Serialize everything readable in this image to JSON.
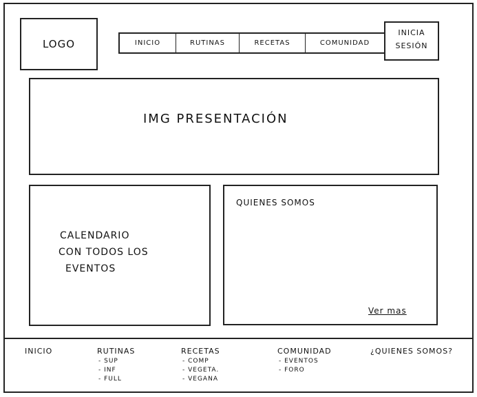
{
  "header": {
    "logo": "LOGO",
    "nav": [
      "INICIO",
      "RUTINAS",
      "RECETAS",
      "COMUNIDAD"
    ],
    "login_line1": "INICIA",
    "login_line2": "SESIÓN"
  },
  "hero": {
    "label": "IMG PRESENTACIÓN"
  },
  "calendar": {
    "lines": [
      "CALENDARIO",
      "CON TODOS LOS",
      "EVENTOS"
    ]
  },
  "about": {
    "title": "QUIENES SOMOS",
    "link": "Ver mas"
  },
  "footer": {
    "inicio": "INICIO",
    "rutinas": {
      "title": "RUTINAS",
      "items": [
        "- SUP",
        "- INF",
        "- FULL"
      ]
    },
    "recetas": {
      "title": "RECETAS",
      "items": [
        "- COMP",
        "- VEGETA.",
        "- VEGANA"
      ]
    },
    "comunidad": {
      "title": "COMUNIDAD",
      "items": [
        "- EVENTOS",
        "- FORO"
      ]
    },
    "quienes": "¿QUIENES SOMOS?"
  }
}
